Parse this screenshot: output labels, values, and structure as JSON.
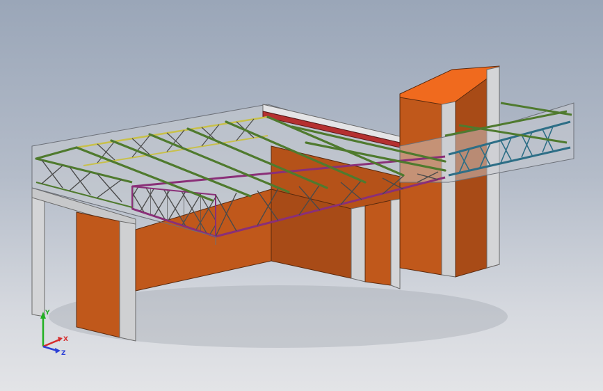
{
  "colors": {
    "background_top": "#9aa6b8",
    "background_bottom": "#e3e4e7",
    "wall_orange": "#c0581b",
    "wall_orange_light": "#f06a1e",
    "column_grey": "#c9cacc",
    "truss_green": "#4f7a2e",
    "truss_magenta": "#8a2f78",
    "truss_teal": "#2d6e86",
    "truss_yellow": "#c8c04a",
    "axis_x": "#d62b2b",
    "axis_y": "#21b021",
    "axis_z": "#2b3fd6"
  },
  "triad": {
    "x_label": "X",
    "y_label": "Y",
    "z_label": "Z"
  }
}
